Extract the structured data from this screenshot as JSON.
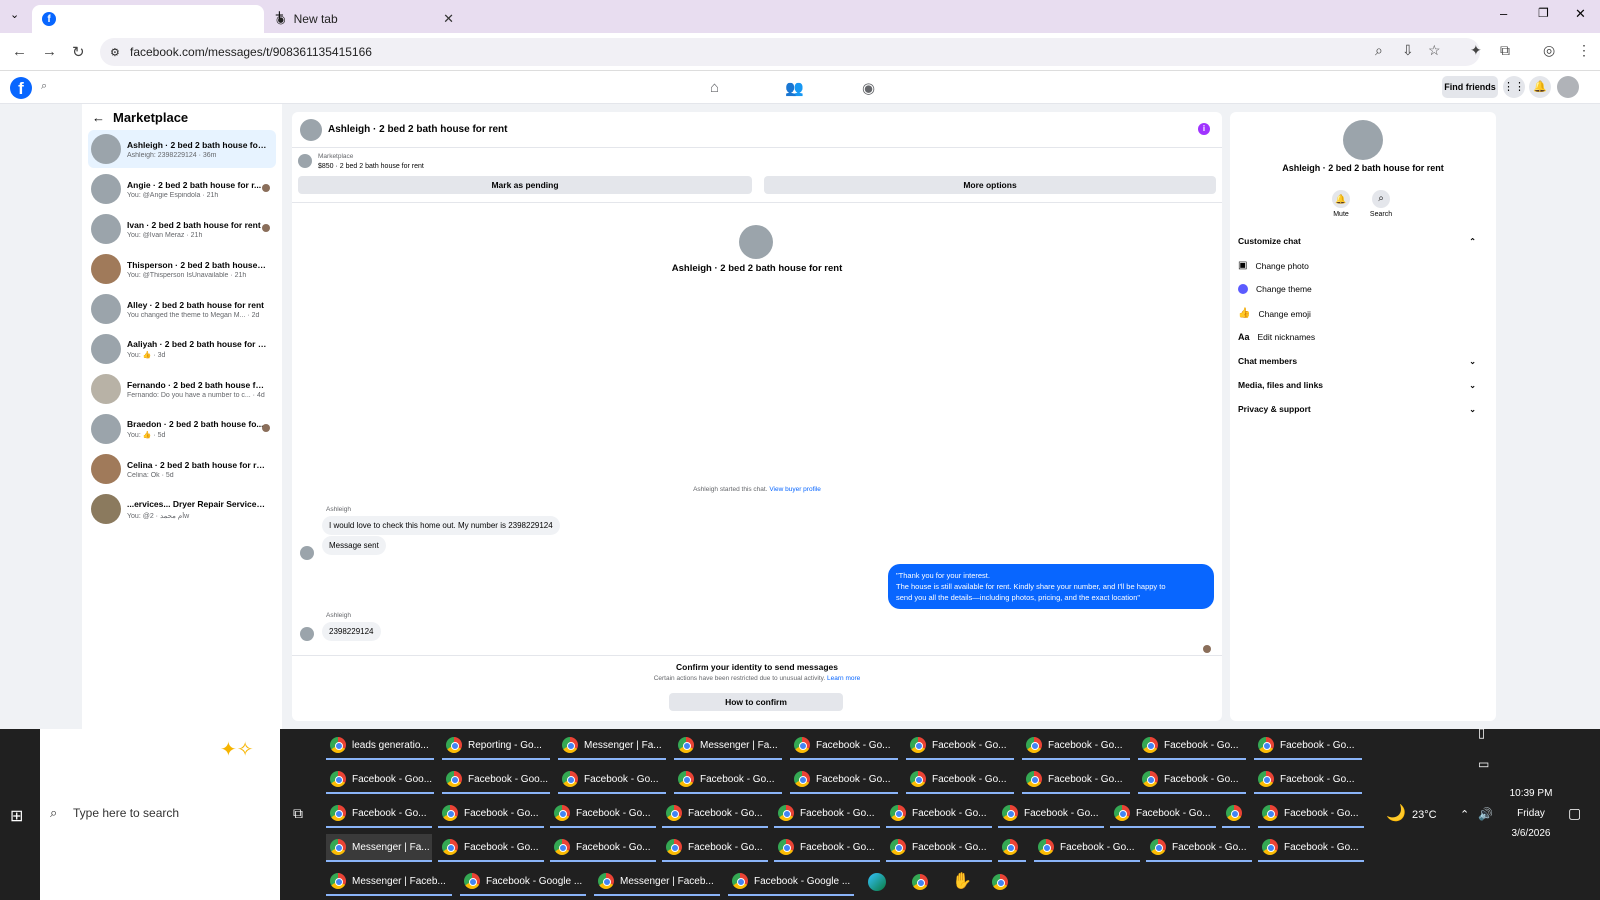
{
  "browser": {
    "active_tab": "",
    "tab2": "New tab",
    "url": "facebook.com/messages/t/908361135415166"
  },
  "fb": {
    "find_friends": "Find friends"
  },
  "sidebar": {
    "title": "Marketplace",
    "items": [
      {
        "name": "Ashleigh · 2 bed 2 bath house for r...",
        "sub": "Ashleigh: 2398229124 · 36m"
      },
      {
        "name": "Angie · 2 bed 2 bath house for r...",
        "sub": "You: @Angie Espindola · 21h"
      },
      {
        "name": "Ivan · 2 bed 2 bath house for rent",
        "sub": "You: @Ivan Meraz · 21h"
      },
      {
        "name": "Thisperson · 2 bed 2 bath house fo...",
        "sub": "You: @Thisperson IsUnavailable · 21h"
      },
      {
        "name": "Alley · 2 bed 2 bath house for rent",
        "sub": "You changed the theme to Megan M... · 2d"
      },
      {
        "name": "Aaliyah · 2 bed 2 bath house for re...",
        "sub": "You: 👍 · 3d"
      },
      {
        "name": "Fernando · 2 bed 2 bath house for ...",
        "sub": "Fernando: Do you have a number to c... · 4d"
      },
      {
        "name": "Braedon · 2 bed 2 bath house fo...",
        "sub": "You: 👍 · 5d"
      },
      {
        "name": "Celina · 2 bed 2 bath house for rent",
        "sub": "Celina: Ok · 5d"
      },
      {
        "name": "...ervices... Dryer Repair Services · أم",
        "sub": "You: @أم محمد · 2w"
      }
    ]
  },
  "chat": {
    "title": "Ashleigh · 2 bed 2 bath house for rent",
    "mk_label": "Marketplace",
    "mk_item": "$850 · 2 bed 2 bath house for rent",
    "pending": "Mark as pending",
    "more": "More options",
    "center_name": "Ashleigh · 2 bed 2 bath house for rent",
    "started": "Ashleigh started this chat.",
    "view_profile": "View buyer profile",
    "sender1": "Ashleigh",
    "msg1": "I would love to check this home out. My number is 2398229124",
    "msg2": "Message sent",
    "reply1": "\"Thank you for your interest.",
    "reply2": "The house is still available for rent. Kindly share your number, and I'll be happy to",
    "reply3": "send you all the details—including photos, pricing, and the exact location\"",
    "sender2": "Ashleigh",
    "msg3": "2398229124",
    "confirm_title": "Confirm your identity to send messages",
    "confirm_sub": "Certain actions have been restricted due to unusual activity.",
    "learn": "Learn more",
    "how": "How to confirm"
  },
  "right": {
    "name": "Ashleigh · 2 bed 2 bath house for rent",
    "mute": "Mute",
    "search": "Search",
    "customize": "Customize chat",
    "change_photo": "Change photo",
    "change_theme": "Change theme",
    "change_emoji": "Change emoji",
    "edit_nick": "Edit nicknames",
    "members": "Chat members",
    "media": "Media, files and links",
    "privacy": "Privacy & support"
  },
  "taskbar": {
    "search": "Type here to search",
    "temp": "23°C",
    "time": "10:39 PM",
    "day": "Friday",
    "date": "3/6/2026",
    "row1": [
      "leads generatio...",
      "Reporting - Go...",
      "Messenger | Fa...",
      "Messenger | Fa...",
      "Facebook - Go...",
      "Facebook - Go...",
      "Facebook - Go...",
      "Facebook - Go...",
      "Facebook - Go..."
    ],
    "row2": [
      "Facebook - Goo...",
      "Facebook - Goo...",
      "Facebook - Go...",
      "Facebook - Go...",
      "Facebook - Go...",
      "Facebook - Go...",
      "Facebook - Go...",
      "Facebook - Go...",
      "Facebook - Go..."
    ],
    "row3": [
      "Facebook - Go...",
      "Facebook - Go...",
      "Facebook - Go...",
      "Facebook - Go...",
      "Facebook - Go...",
      "Facebook - Go...",
      "Facebook - Go...",
      "Facebook - Go...",
      "",
      "Facebook - Go..."
    ],
    "row4": [
      "Messenger | Fa...",
      "Facebook - Go...",
      "Facebook - Go...",
      "Facebook - Go...",
      "Facebook - Go...",
      "Facebook - Go...",
      "",
      "Facebook - Go...",
      "Facebook - Go...",
      "Facebook - Go..."
    ],
    "row5": [
      "Messenger | Faceb...",
      "Facebook - Google ...",
      "Messenger | Faceb...",
      "Facebook - Google ..."
    ]
  }
}
